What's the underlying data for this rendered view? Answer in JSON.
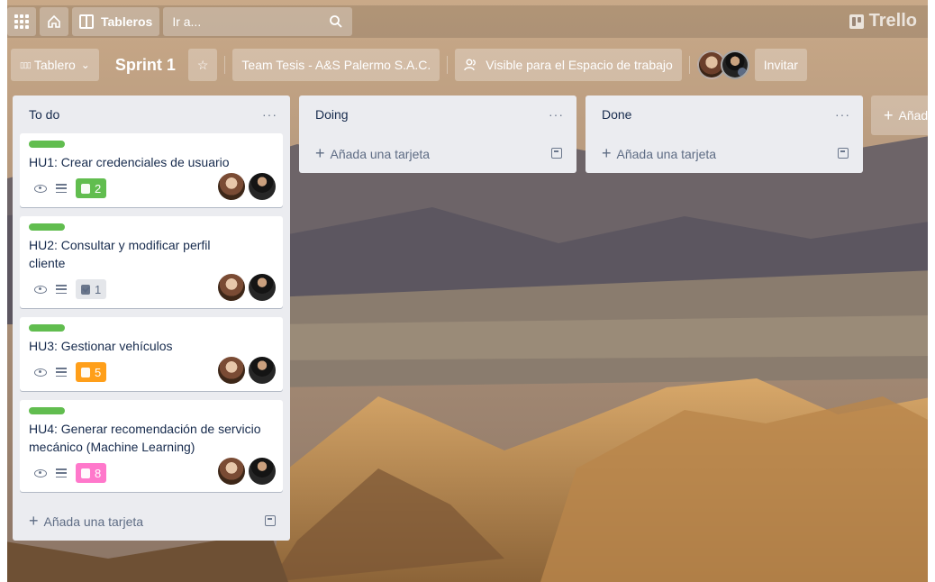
{
  "nav": {
    "boards_label": "Tableros",
    "search_placeholder": "Ir a...",
    "brand": "Trello"
  },
  "board": {
    "view_label": "Tablero",
    "title": "Sprint 1",
    "workspace": "Team Tesis - A&S Palermo S.A.C.",
    "visibility": "Visible para el Espacio de trabajo",
    "invite_label": "Invitar"
  },
  "lists": [
    {
      "title": "To do",
      "menu": "···",
      "cards": [
        {
          "title": "HU1: Crear credenciales de usuario",
          "checklist": "2",
          "badge_color": "#61bd4f"
        },
        {
          "title": "HU2: Consultar y modificar perfil cliente",
          "checklist": "1",
          "badge_color": "#e4e6ea"
        },
        {
          "title": "HU3: Gestionar vehículos",
          "checklist": "5",
          "badge_color": "#ff9f1a"
        },
        {
          "title": "HU4: Generar recomendación de servicio mecánico (Machine Learning)",
          "checklist": "8",
          "badge_color": "#ff78cb"
        }
      ],
      "add_card": "Añada una tarjeta"
    },
    {
      "title": "Doing",
      "menu": "···",
      "add_card": "Añada una tarjeta"
    },
    {
      "title": "Done",
      "menu": "···",
      "add_card": "Añada una tarjeta"
    }
  ],
  "add_list": "Añada",
  "icons": {
    "apps": "apps-grid-icon",
    "home": "home-icon",
    "boards": "boards-icon",
    "search": "search-icon",
    "star": "star-icon",
    "visibility": "people-icon",
    "watch": "eye-icon",
    "description": "description-icon",
    "checklist": "checklist-icon",
    "template": "template-icon"
  }
}
